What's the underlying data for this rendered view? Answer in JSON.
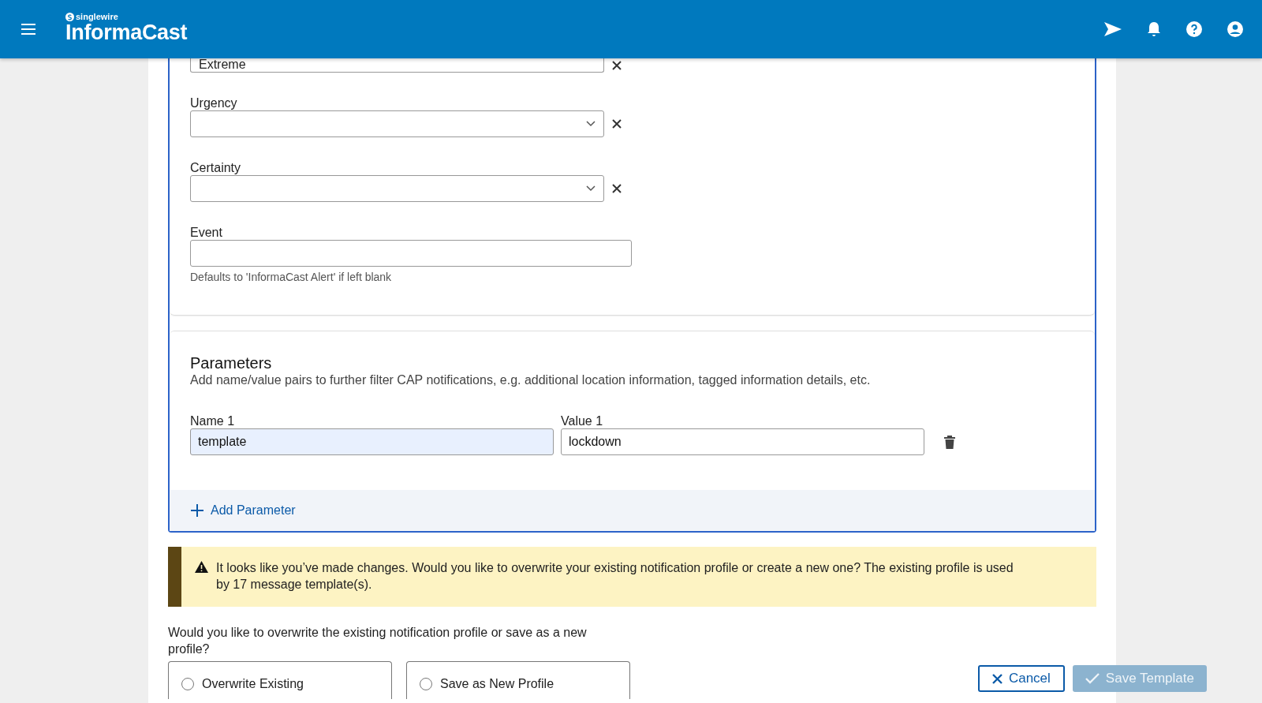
{
  "header": {
    "brand_small": "singlewire",
    "brand": "InformaCast"
  },
  "fields": [
    {
      "kind": "select",
      "value": "Extreme",
      "clearable": true
    },
    {
      "kind": "select",
      "label": "Urgency",
      "clearable": true
    },
    {
      "kind": "select",
      "label": "Certainty",
      "clearable": true
    },
    {
      "kind": "text",
      "label": "Event",
      "hint": "Defaults to 'InformaCast Alert' if left blank"
    }
  ],
  "parameters": {
    "title": "Parameters",
    "description": "Add name/value pairs to further filter CAP notifications, e.g. additional location information, tagged information details, etc.",
    "rows": [
      {
        "name_label": "Name 1",
        "name": "template",
        "name_highlighted": true,
        "value_label": "Value 1",
        "value": "lockdown"
      }
    ],
    "add_label": "Add Parameter"
  },
  "warning": "It looks like you’ve made changes. Would you like to overwrite your existing notification profile or create a new one? The existing profile is used by 17 message template(s).",
  "question": "Would you like to overwrite the existing notification profile or save as a new profile?",
  "options": [
    {
      "label": "Overwrite Existing",
      "selected": false
    },
    {
      "label": "Save as New Profile",
      "selected": false
    }
  ],
  "buttons": [
    {
      "kind": "cancel",
      "label": "Cancel",
      "disabled": false
    },
    {
      "kind": "save",
      "label": "Save Template",
      "disabled": true
    }
  ]
}
